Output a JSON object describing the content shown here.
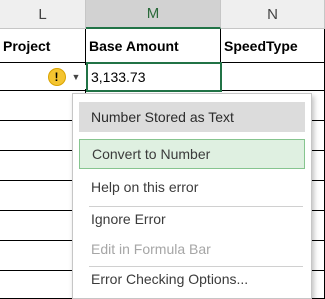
{
  "columns": [
    "L",
    "M",
    "N"
  ],
  "headers": {
    "l": "Project",
    "m": "Base Amount",
    "n": "SpeedType"
  },
  "active_cell": {
    "value": "3,133.73"
  },
  "error_button": {
    "icon": "warning-icon",
    "glyph": "!",
    "caret": "▼"
  },
  "menu": {
    "title": "Number Stored as Text",
    "items": [
      {
        "label": "Convert to Number",
        "enabled": true,
        "hover": true
      },
      {
        "label": "Help on this error",
        "enabled": true
      },
      {
        "label": "Ignore Error",
        "enabled": true
      },
      {
        "label": "Edit in Formula Bar",
        "enabled": false
      },
      {
        "label": "Error Checking Options...",
        "enabled": true
      }
    ]
  },
  "colors": {
    "accent": "#217346",
    "warning": "#f4c430",
    "hover": "#dff0e1"
  }
}
